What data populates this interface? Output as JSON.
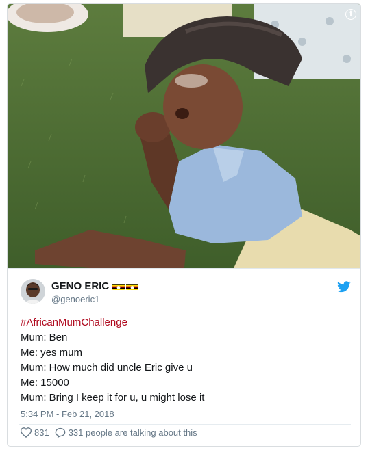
{
  "media": {
    "icon": "info-icon",
    "info_glyph": "i"
  },
  "author": {
    "display_name": "GENO ERIC",
    "handle": "@genoeric1",
    "flags": [
      "uganda-flag",
      "uganda-flag"
    ],
    "brand_icon": "twitter-bird-icon",
    "brand_color": "#1da1f2"
  },
  "tweet": {
    "hashtag": "#AfricanMumChallenge",
    "hashtag_color": "#b00a1f",
    "lines": [
      "Mum: Ben",
      "Me: yes mum",
      "Mum: How much did uncle Eric give u",
      "Me: 15000",
      "Mum: Bring I keep it for u, u might lose it"
    ],
    "timestamp": "5:34 PM - Feb 21, 2018"
  },
  "actions": {
    "likes_icon": "heart-icon",
    "likes_count": "831",
    "replies_icon": "reply-bubble-icon",
    "talking_text": "331 people are talking about this"
  }
}
